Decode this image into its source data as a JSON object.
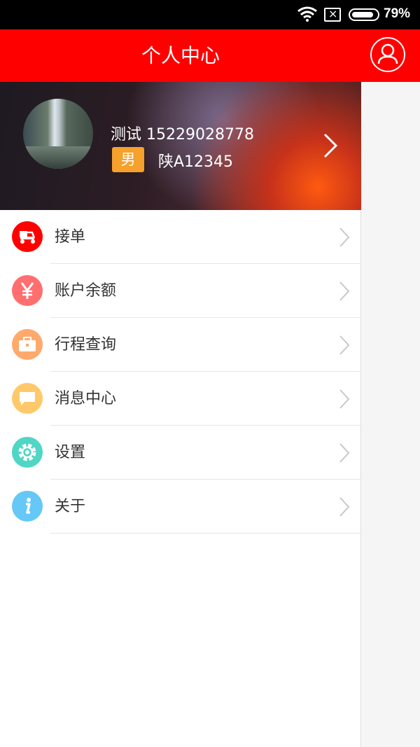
{
  "status_bar": {
    "battery": "79%",
    "battery_level": 0.79
  },
  "drawer": {
    "title": "个人中心",
    "profile": {
      "name_phone": "测试 15229028778",
      "gender": "男",
      "plate": "陕A12345"
    },
    "menu": [
      {
        "label": "接单",
        "icon": "scooter-icon",
        "color": "#ff0000"
      },
      {
        "label": "账户余额",
        "icon": "yen-icon",
        "color": "#ff6f6f"
      },
      {
        "label": "行程查询",
        "icon": "briefcase-icon",
        "color": "#ffa96c"
      },
      {
        "label": "消息中心",
        "icon": "message-icon",
        "color": "#ffc96b"
      },
      {
        "label": "设置",
        "icon": "gear-icon",
        "color": "#4fd6c4"
      },
      {
        "label": "关于",
        "icon": "info-icon",
        "color": "#65c8f6"
      }
    ]
  },
  "colors": {
    "accent": "#ff0000",
    "gender_badge": "#f5a12c"
  }
}
